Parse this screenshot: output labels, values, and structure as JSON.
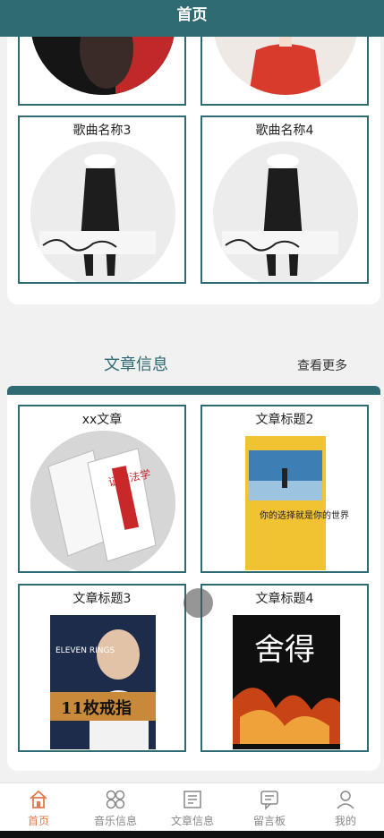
{
  "header": {
    "title": "首页"
  },
  "music": {
    "items": [
      {
        "label": ""
      },
      {
        "label": ""
      },
      {
        "label": "歌曲名称3"
      },
      {
        "label": "歌曲名称4"
      }
    ]
  },
  "articles": {
    "title": "文章信息",
    "more": "查看更多",
    "items": [
      {
        "label": "xx文章",
        "cover_text": "证据法学"
      },
      {
        "label": "文章标题2",
        "cover_text": "你的选择就是你的世界"
      },
      {
        "label": "文章标题3",
        "cover_text": "11枚戒指",
        "cover_sub": "ELEVEN RINGS"
      },
      {
        "label": "文章标题4",
        "cover_text": "舍得"
      }
    ]
  },
  "tabbar": {
    "items": [
      {
        "label": "首页",
        "icon": "home-icon",
        "active": true
      },
      {
        "label": "音乐信息",
        "icon": "grid-icon",
        "active": false
      },
      {
        "label": "文章信息",
        "icon": "article-icon",
        "active": false
      },
      {
        "label": "留言板",
        "icon": "message-icon",
        "active": false
      },
      {
        "label": "我的",
        "icon": "user-icon",
        "active": false
      }
    ]
  },
  "colors": {
    "primary": "#2f6b73",
    "accent": "#e07a50"
  }
}
